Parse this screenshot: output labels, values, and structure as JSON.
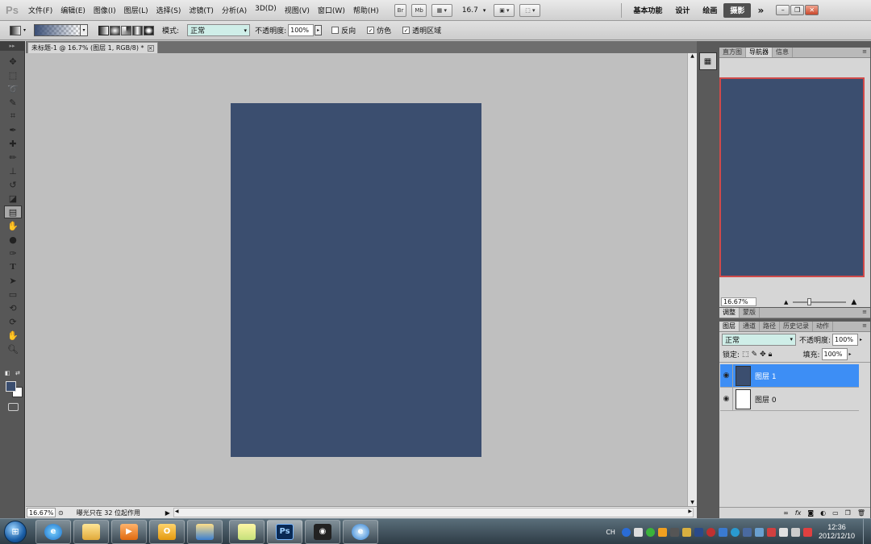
{
  "app": {
    "logo": "Ps"
  },
  "menu": {
    "items": [
      "文件(F)",
      "编辑(E)",
      "图像(I)",
      "图层(L)",
      "选择(S)",
      "滤镜(T)",
      "分析(A)",
      "3D(D)",
      "视图(V)",
      "窗口(W)",
      "帮助(H)"
    ],
    "bridge_label": "Br",
    "minibridge_label": "Mb",
    "zoom_value": "16.7",
    "workspaces": [
      "基本功能",
      "设计",
      "绘画",
      "摄影"
    ],
    "active_workspace": "摄影",
    "more_label": "»"
  },
  "options": {
    "mode_label": "模式:",
    "mode_value": "正常",
    "opacity_label": "不透明度:",
    "opacity_value": "100%",
    "reverse_label": "反向",
    "dither_label": "仿色",
    "transparency_label": "透明区域",
    "reverse_checked": false,
    "dither_checked": true,
    "transparency_checked": true
  },
  "document": {
    "tab_title": "未标题-1 @ 16.7% (图层 1, RGB/8) *",
    "canvas_color": "#3b4e6f",
    "zoom": "16.67%",
    "status_text": "曝光只在 32 位起作用"
  },
  "navigator": {
    "tabs": [
      "直方图",
      "导航器",
      "信息"
    ],
    "active_tab": "导航器",
    "zoom_value": "16.67%"
  },
  "adjustments": {
    "tabs": [
      "调整",
      "蒙版"
    ]
  },
  "layers_panel": {
    "tabs": [
      "图层",
      "通道",
      "路径",
      "历史记录",
      "动作"
    ],
    "active_tab": "图层",
    "blend_mode": "正常",
    "opacity_label": "不透明度:",
    "opacity_value": "100%",
    "lock_label": "锁定:",
    "fill_label": "填充:",
    "fill_value": "100%",
    "layers": [
      {
        "name": "图层 1",
        "selected": true,
        "thumb_color": "#3b4e6f"
      },
      {
        "name": "图层 0",
        "selected": false,
        "thumb_color": "#ffffff"
      }
    ]
  },
  "taskbar": {
    "tray_lang": "CH",
    "clock_time": "12:36",
    "clock_date": "2012/12/10"
  }
}
